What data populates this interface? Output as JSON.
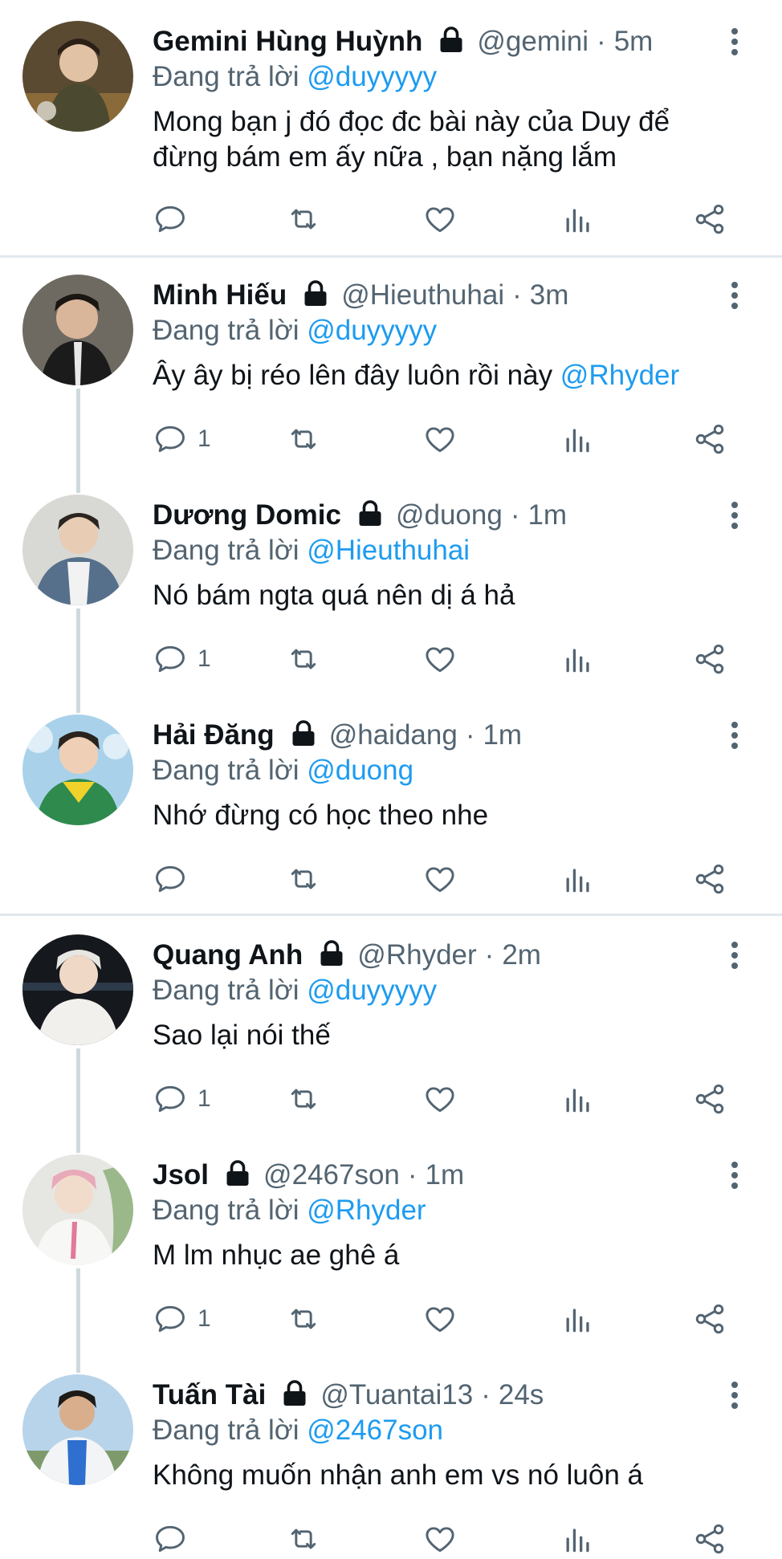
{
  "tweets": [
    {
      "name": "Gemini Hùng Huỳnh",
      "handle": "@gemini",
      "dot": "·",
      "time": "5m",
      "reply_prefix": "Đang trả lời",
      "reply_to": "@duyyyyy",
      "text_plain": "Mong bạn j đó đọc đc bài này của Duy để đừng bám em ấy nữa , bạn nặng lắm",
      "text_mention": "",
      "reply_count": ""
    },
    {
      "name": "Minh Hiếu",
      "handle": "@Hieuthuhai",
      "dot": "·",
      "time": "3m",
      "reply_prefix": "Đang trả lời",
      "reply_to": "@duyyyyy",
      "text_plain": "Ây ây bị réo lên đây luôn rồi này ",
      "text_mention": "@Rhyder",
      "reply_count": "1"
    },
    {
      "name": "Dương Domic",
      "handle": "@duong",
      "dot": "·",
      "time": "1m",
      "reply_prefix": "Đang trả lời",
      "reply_to": "@Hieuthuhai",
      "text_plain": "Nó bám ngta quá nên dị á hả",
      "text_mention": "",
      "reply_count": "1"
    },
    {
      "name": "Hải Đăng",
      "handle": "@haidang",
      "dot": "·",
      "time": "1m",
      "reply_prefix": "Đang trả lời",
      "reply_to": "@duong",
      "text_plain": "Nhớ đừng có học theo nhe",
      "text_mention": "",
      "reply_count": ""
    },
    {
      "name": "Quang Anh",
      "handle": "@Rhyder",
      "dot": "·",
      "time": "2m",
      "reply_prefix": "Đang trả lời",
      "reply_to": "@duyyyyy",
      "text_plain": "Sao lại nói thế",
      "text_mention": "",
      "reply_count": "1"
    },
    {
      "name": "Jsol",
      "handle": "@2467son",
      "dot": "·",
      "time": "1m",
      "reply_prefix": "Đang trả lời",
      "reply_to": "@Rhyder",
      "text_plain": "M lm nhục ae ghê á",
      "text_mention": "",
      "reply_count": "1"
    },
    {
      "name": "Tuấn Tài",
      "handle": "@Tuantai13",
      "dot": "·",
      "time": "24s",
      "reply_prefix": "Đang trả lời",
      "reply_to": "@2467son",
      "text_plain": "Không muốn nhận anh em vs nó luôn á",
      "text_mention": "",
      "reply_count": ""
    }
  ],
  "icons": {
    "reply": "reply-icon",
    "retweet": "retweet-icon",
    "like": "heart-icon",
    "views": "views-icon",
    "share": "share-icon",
    "lock": "lock-icon",
    "more": "more-options-icon"
  },
  "colors": {
    "text": "#0f1419",
    "secondary": "#536471",
    "mention": "#1d9bf0",
    "thread_line": "#cfd9de",
    "divider": "#e1e8ed"
  }
}
